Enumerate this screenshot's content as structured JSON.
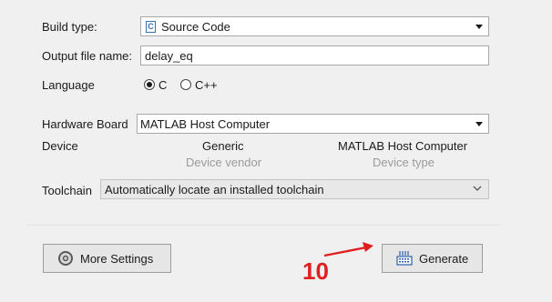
{
  "build_type": {
    "label": "Build type:",
    "value": "Source Code",
    "icon": "c-file-icon"
  },
  "output_file": {
    "label": "Output file name:",
    "value": "delay_eq"
  },
  "language": {
    "label": "Language",
    "options": [
      {
        "label": "C",
        "checked": true
      },
      {
        "label": "C++",
        "checked": false
      }
    ]
  },
  "hardware": {
    "label": "Hardware Board",
    "value": "MATLAB Host Computer"
  },
  "device": {
    "label": "Device",
    "vendor_value": "Generic",
    "vendor_caption": "Device vendor",
    "type_value": "MATLAB Host Computer",
    "type_caption": "Device type"
  },
  "toolchain": {
    "label": "Toolchain",
    "value": "Automatically locate an installed toolchain"
  },
  "buttons": {
    "more_settings": "More Settings",
    "more_settings_icon": "gear-icon",
    "generate": "Generate",
    "generate_icon": "generate-code-icon"
  },
  "annotation": {
    "step_number": "10",
    "color": "#e02020"
  }
}
